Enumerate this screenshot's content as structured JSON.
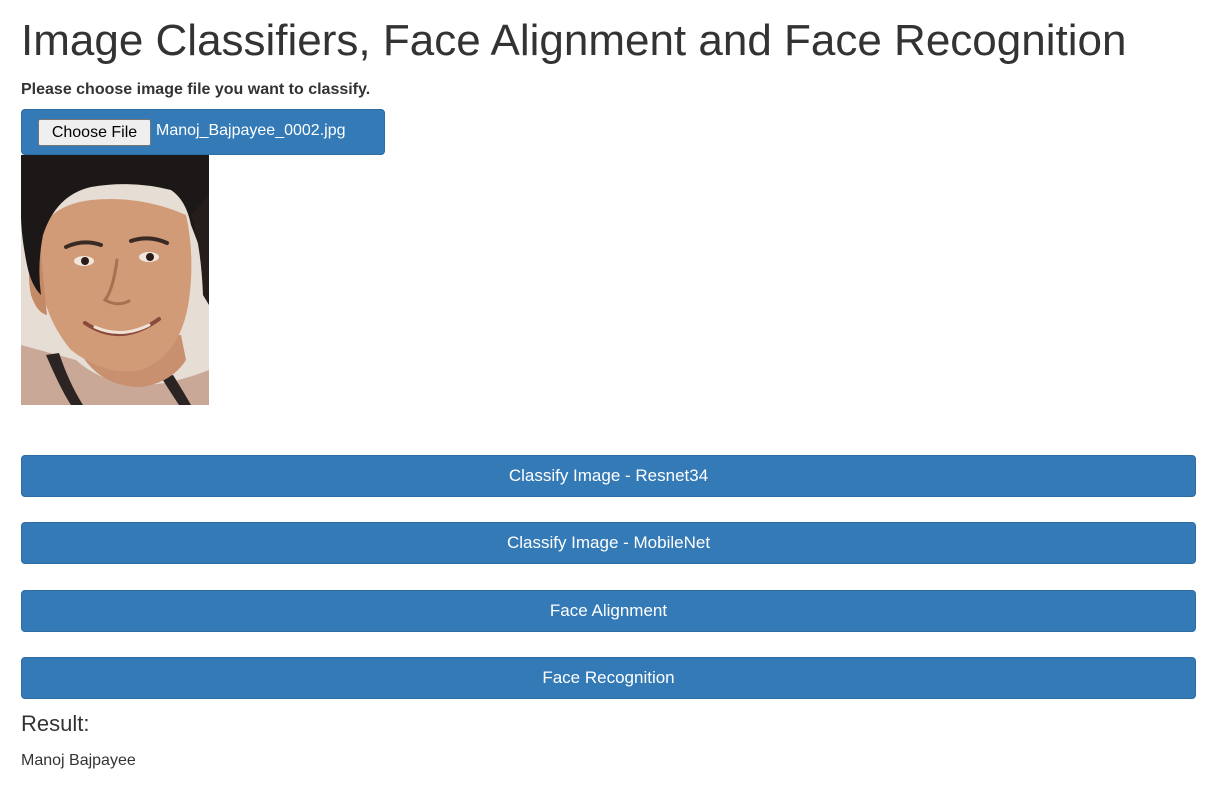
{
  "page": {
    "title": "Image Classifiers, Face Alignment and Face Recognition",
    "prompt": "Please choose image file you want to classify."
  },
  "file_input": {
    "button_label": "Choose File",
    "selected_file": "Manoj_Bajpayee_0002.jpg"
  },
  "actions": {
    "classify_resnet": "Classify Image - Resnet34",
    "classify_mobilenet": "Classify Image - MobileNet",
    "face_alignment": "Face Alignment",
    "face_recognition": "Face Recognition"
  },
  "result": {
    "label": "Result:",
    "value": "Manoj Bajpayee"
  },
  "colors": {
    "primary": "#337ab7",
    "primary_border": "#2e6da4",
    "text": "#333333"
  }
}
